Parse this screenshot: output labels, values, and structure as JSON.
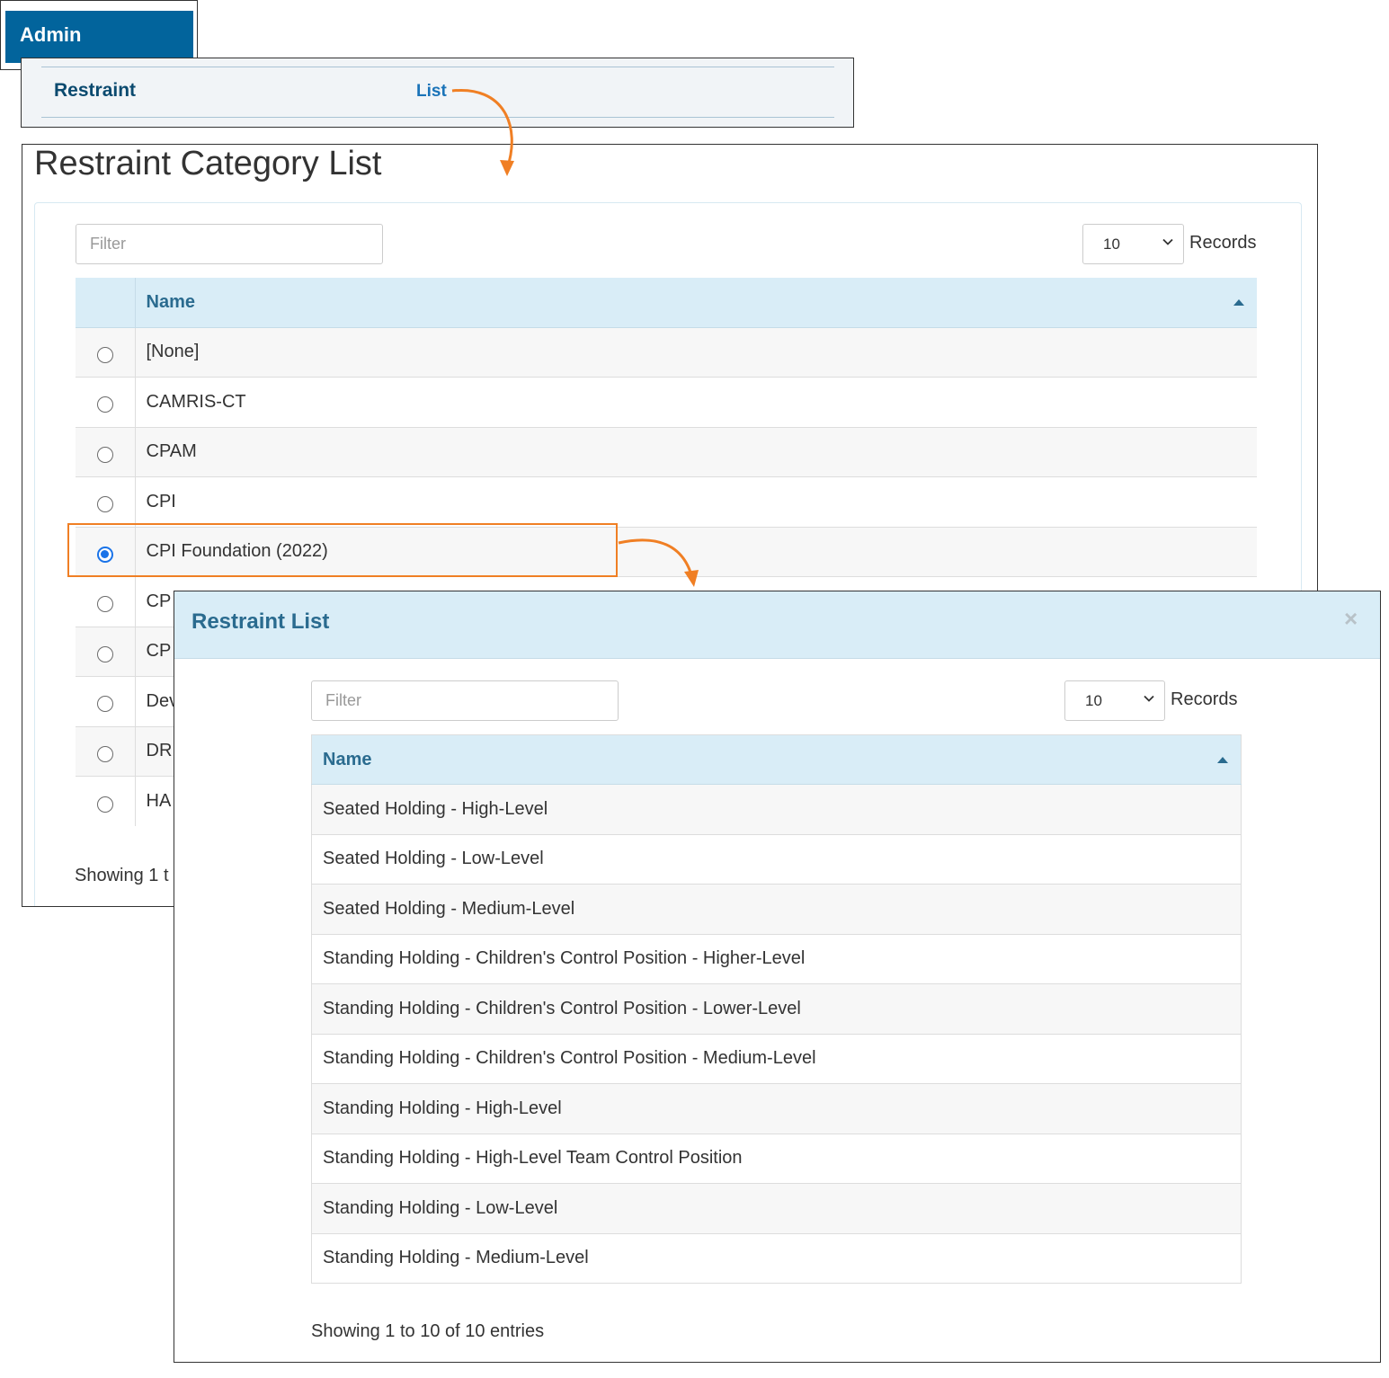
{
  "nav": {
    "admin_tab": "Admin",
    "submenu_title": "Restraint",
    "submenu_link": "List"
  },
  "category_list": {
    "title": "Restraint Category List",
    "filter_placeholder": "Filter",
    "records_value": "10",
    "records_label": "Records",
    "column_name": "Name",
    "rows": [
      {
        "name": "[None]",
        "selected": false
      },
      {
        "name": "CAMRIS-CT",
        "selected": false
      },
      {
        "name": "CPAM",
        "selected": false
      },
      {
        "name": "CPI",
        "selected": false
      },
      {
        "name": "CPI Foundation (2022)",
        "selected": true
      },
      {
        "name": "CP",
        "selected": false
      },
      {
        "name": "CP",
        "selected": false
      },
      {
        "name": "Dev",
        "selected": false
      },
      {
        "name": "DR",
        "selected": false
      },
      {
        "name": "HA",
        "selected": false
      }
    ],
    "info": "Showing 1 t"
  },
  "restraint_modal": {
    "title": "Restraint List",
    "close": "×",
    "filter_placeholder": "Filter",
    "records_value": "10",
    "records_label": "Records",
    "column_name": "Name",
    "rows": [
      "Seated Holding - High-Level",
      "Seated Holding - Low-Level",
      "Seated Holding - Medium-Level",
      "Standing Holding - Children's Control Position - Higher-Level",
      "Standing Holding - Children's Control Position - Lower-Level",
      "Standing Holding - Children's Control Position - Medium-Level",
      "Standing Holding - High-Level",
      "Standing Holding - High-Level Team Control Position",
      "Standing Holding - Low-Level",
      "Standing Holding - Medium-Level"
    ],
    "info": "Showing 1 to 10 of 10 entries"
  },
  "colors": {
    "admin_blue": "#02649c",
    "header_blue": "#d9edf7",
    "accent_orange": "#f07f24",
    "radio_selected": "#1a73e8"
  },
  "icons": [
    "chevron-down-icon",
    "sort-ascending-icon",
    "close-icon",
    "callout-arrow-icon"
  ]
}
